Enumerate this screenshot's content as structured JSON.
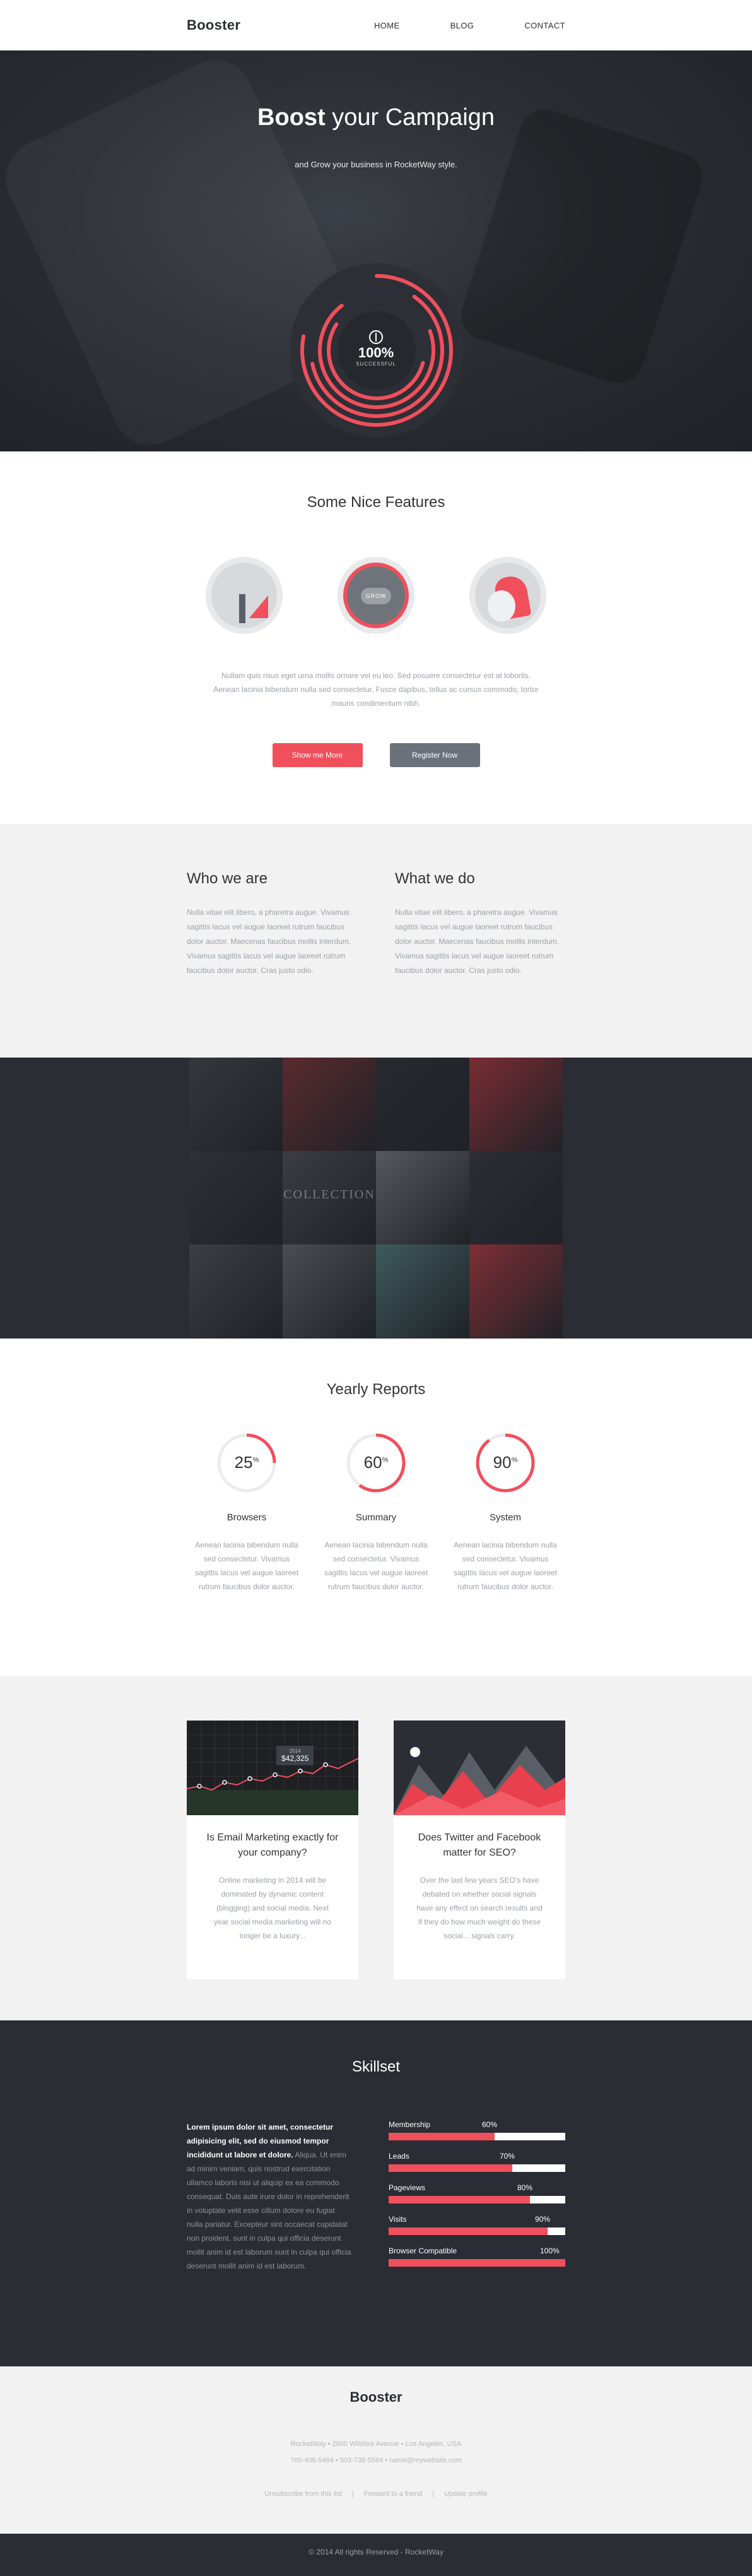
{
  "header": {
    "brand": "Booster",
    "nav": [
      "HOME",
      "BLOG",
      "CONTACT"
    ]
  },
  "hero": {
    "title_bold": "Boost",
    "title_rest": " your Campaign",
    "subtitle": "and Grow your business in RocketWay style.",
    "gauge_value": "100%",
    "gauge_label": "SUCCESSFUL",
    "gauge_progress": 1.0
  },
  "features": {
    "title": "Some Nice Features",
    "icons": [
      "analytics-icon",
      "grow-icon",
      "rocket-icon"
    ],
    "grow_label": "GROW",
    "text": "Nullam quis risus eget urna mollis ornare vel eu leo. Sed posuere consectetur est at lobortis. Aenean lacinia bibendum nulla sed consectetur. Fusce dapibus, tellus ac cursus commodo, tortor mauris condimentum nibh.",
    "btn_primary": "Show me More",
    "btn_secondary": "Register Now"
  },
  "about": {
    "left_title": "Who we are",
    "left_text": "Nulla vitae elit libero, a pharetra augue. Vivamus sagittis lacus vel augue laoreet rutrum faucibus dolor auctor. Maecenas faucibus mollis interdum. Vivamus sagittis lacus vel augue laoreet rutrum faucibus dolor auctor. Cras justo odio.",
    "right_title": "What we do",
    "right_text": "Nulla vitae elit libero, a pharetra augue. Vivamus sagittis lacus vel augue laoreet rutrum faucibus dolor auctor. Maecenas faucibus mollis interdum. Vivamus sagittis lacus vel augue laoreet rutrum faucibus dolor auctor. Cras justo odio."
  },
  "gallery": {
    "tile_labels": [
      "",
      "",
      "",
      "",
      "",
      "COLLECTION",
      "",
      "",
      "",
      "",
      "",
      ""
    ],
    "tile_colors": [
      "#34373d",
      "#5a2a2e",
      "#26292e",
      "#7a2c33",
      "#2d3036",
      "#3a3d43",
      "#55585d",
      "#2b2e34",
      "#3b3e44",
      "#4a4d52",
      "#3e5a5c",
      "#7e2e35"
    ]
  },
  "reports": {
    "title": "Yearly Reports",
    "items": [
      {
        "value": "25",
        "unit": "%",
        "pct": 0.25,
        "label": "Browsers",
        "text": "Aenean lacinia bibendum nulla sed consectetur. Vivamus sagittis lacus vel augue laoreet rutrum faucibus dolor auctor."
      },
      {
        "value": "60",
        "unit": "%",
        "pct": 0.6,
        "label": "Summary",
        "text": "Aenean lacinia bibendum nulla sed consectetur. Vivamus sagittis lacus vel augue laoreet rutrum faucibus dolor auctor."
      },
      {
        "value": "90",
        "unit": "%",
        "pct": 0.9,
        "label": "System",
        "text": "Aenean lacinia bibendum nulla sed consectetur. Vivamus sagittis lacus vel augue laoreet rutrum faucibus dolor auctor."
      }
    ]
  },
  "blog": {
    "cards": [
      {
        "title": "Is Email Marketing exactly for your company?",
        "text": "Online marketing in 2014 will be dominated by dynamic content (blogging) and social media. Next year social media marketing will no longer be a luxury...",
        "tag_top": "2014",
        "tag_value": "$42,325"
      },
      {
        "title": "Does Twitter and Facebook matter for SEO?",
        "text": "Over the last few years SEO's have debated on whether social signals have any effect on search results and if they do how much weight do these social... signals carry."
      }
    ]
  },
  "skills": {
    "title": "Skillset",
    "intro_bold": "Lorem ipsum dolor sit amet, consectetur adipisicing elit, sed do eiusmod tempor incididunt ut labore et dolore.",
    "intro_text": "Aliqua. Ut enim ad minim veniam, quis nostrud exercitation ullamco laboris nisi ut aliquip ex ea commodo consequat. Duis aute irure dolor in reprehenderit in voluptate velit esse cillum dolore eu fugiat nulla pariatur. Excepteur sint occaecat cupidatat non proident, sunt in culpa qui officia deserunt mollit anim id est laborum sunt in culpa qui officia deserunt mollit anim id est laborum.",
    "bars": [
      {
        "label": "Membership",
        "value": "60%",
        "pct": 0.6
      },
      {
        "label": "Leads",
        "value": "70%",
        "pct": 0.7
      },
      {
        "label": "Pageviews",
        "value": "80%",
        "pct": 0.8
      },
      {
        "label": "Visits",
        "value": "90%",
        "pct": 0.9
      },
      {
        "label": "Browser Compatible",
        "value": "100%",
        "pct": 1.0
      }
    ]
  },
  "footer": {
    "brand": "Booster",
    "address": "RocketWay • 2800 Wilshire Avenue • Los Angeles, USA",
    "contact": "765-406-5464 • 503-738-5564 • name@mywebsite.com",
    "unsubscribe": "Unsubscribe from this list",
    "forward": "Forward to a friend",
    "update": "Update profile",
    "copyright": "© 2014 All rights Reserved - RocketWay"
  },
  "colors": {
    "accent": "#f04f5c",
    "dark": "#2a2d33",
    "grey_button": "#6b727b",
    "light_bg": "#f2f2f2"
  }
}
